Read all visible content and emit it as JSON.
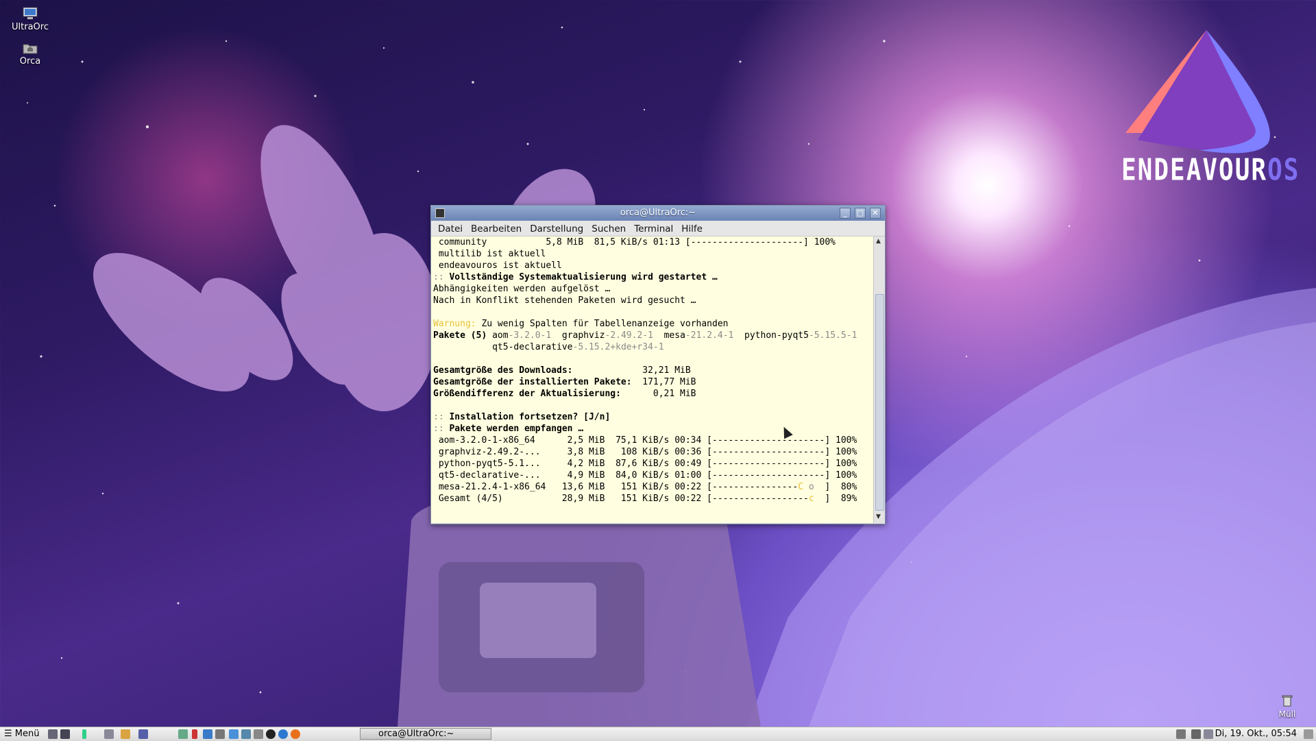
{
  "desktop": {
    "icons": [
      {
        "label": "UltraOrc",
        "icon": "computer-icon"
      },
      {
        "label": "Orca",
        "icon": "home-folder-icon"
      }
    ],
    "trash_label": "Müll",
    "brand": {
      "main": "ENDEAVOUR",
      "suffix": "OS"
    }
  },
  "window": {
    "title": "orca@UltraOrc:~",
    "menu": [
      "Datei",
      "Bearbeiten",
      "Darstellung",
      "Suchen",
      "Terminal",
      "Hilfe"
    ]
  },
  "terminal": {
    "lines": [
      [
        {
          "t": " community           5,8 MiB  81,5 KiB/s 01:13 [---------------------] 100%"
        }
      ],
      [
        {
          "t": " multilib ist aktuell"
        }
      ],
      [
        {
          "t": " endeavouros ist aktuell"
        }
      ],
      [
        {
          "t": ":: ",
          "c": "g"
        },
        {
          "t": "Vollständige Systemaktualisierung wird gestartet …",
          "c": "b"
        }
      ],
      [
        {
          "t": "Abhängigkeiten werden aufgelöst …"
        }
      ],
      [
        {
          "t": "Nach in Konflikt stehenden Paketen wird gesucht …"
        }
      ],
      [
        {
          "t": ""
        }
      ],
      [
        {
          "t": "Warnung:",
          "c": "y"
        },
        {
          "t": " Zu wenig Spalten für Tabellenanzeige vorhanden"
        }
      ],
      [
        {
          "t": "Pakete (5)",
          "c": "b"
        },
        {
          "t": " aom"
        },
        {
          "t": "-3.2.0-1",
          "c": "g"
        },
        {
          "t": "  graphviz"
        },
        {
          "t": "-2.49.2-1",
          "c": "g"
        },
        {
          "t": "  mesa"
        },
        {
          "t": "-21.2.4-1",
          "c": "g"
        },
        {
          "t": "  python-pyqt5"
        },
        {
          "t": "-5.15.5-1",
          "c": "g"
        }
      ],
      [
        {
          "t": "           qt5-declarative"
        },
        {
          "t": "-5.15.2+kde+r34-1",
          "c": "g"
        }
      ],
      [
        {
          "t": ""
        }
      ],
      [
        {
          "t": "Gesamtgröße des Downloads:",
          "c": "b"
        },
        {
          "t": "             32,21 MiB"
        }
      ],
      [
        {
          "t": "Gesamtgröße der installierten Pakete:",
          "c": "b"
        },
        {
          "t": "  171,77 MiB"
        }
      ],
      [
        {
          "t": "Größendifferenz der Aktualisierung:",
          "c": "b"
        },
        {
          "t": "      0,21 MiB"
        }
      ],
      [
        {
          "t": ""
        }
      ],
      [
        {
          "t": ":: ",
          "c": "g"
        },
        {
          "t": "Installation fortsetzen? [J/n]",
          "c": "b"
        }
      ],
      [
        {
          "t": ":: ",
          "c": "g"
        },
        {
          "t": "Pakete werden empfangen …",
          "c": "b"
        }
      ],
      [
        {
          "t": " aom-3.2.0-1-x86_64      2,5 MiB  75,1 KiB/s 00:34 [---------------------] 100%"
        }
      ],
      [
        {
          "t": " graphviz-2.49.2-...     3,8 MiB   108 KiB/s 00:36 [---------------------] 100%"
        }
      ],
      [
        {
          "t": " python-pyqt5-5.1...     4,2 MiB  87,6 KiB/s 00:49 [---------------------] 100%"
        }
      ],
      [
        {
          "t": " qt5-declarative-...     4,9 MiB  84,0 KiB/s 01:00 [---------------------] 100%"
        }
      ],
      [
        {
          "t": " mesa-21.2.4-1-x86_64   13,6 MiB   151 KiB/s 00:22 [----------------"
        },
        {
          "t": "C",
          "c": "y"
        },
        {
          "t": " o",
          "c": "g"
        },
        {
          "t": "  ]  80%"
        }
      ],
      [
        {
          "t": " Gesamt (4/5)           28,9 MiB   151 KiB/s 00:22 [------------------"
        },
        {
          "t": "c",
          "c": "y"
        },
        {
          "t": "  ]  89%"
        }
      ]
    ]
  },
  "taskbar": {
    "menu_label": "Menü",
    "task_label": "orca@UltraOrc:~",
    "clock": "Di, 19. Okt., 05:54"
  }
}
